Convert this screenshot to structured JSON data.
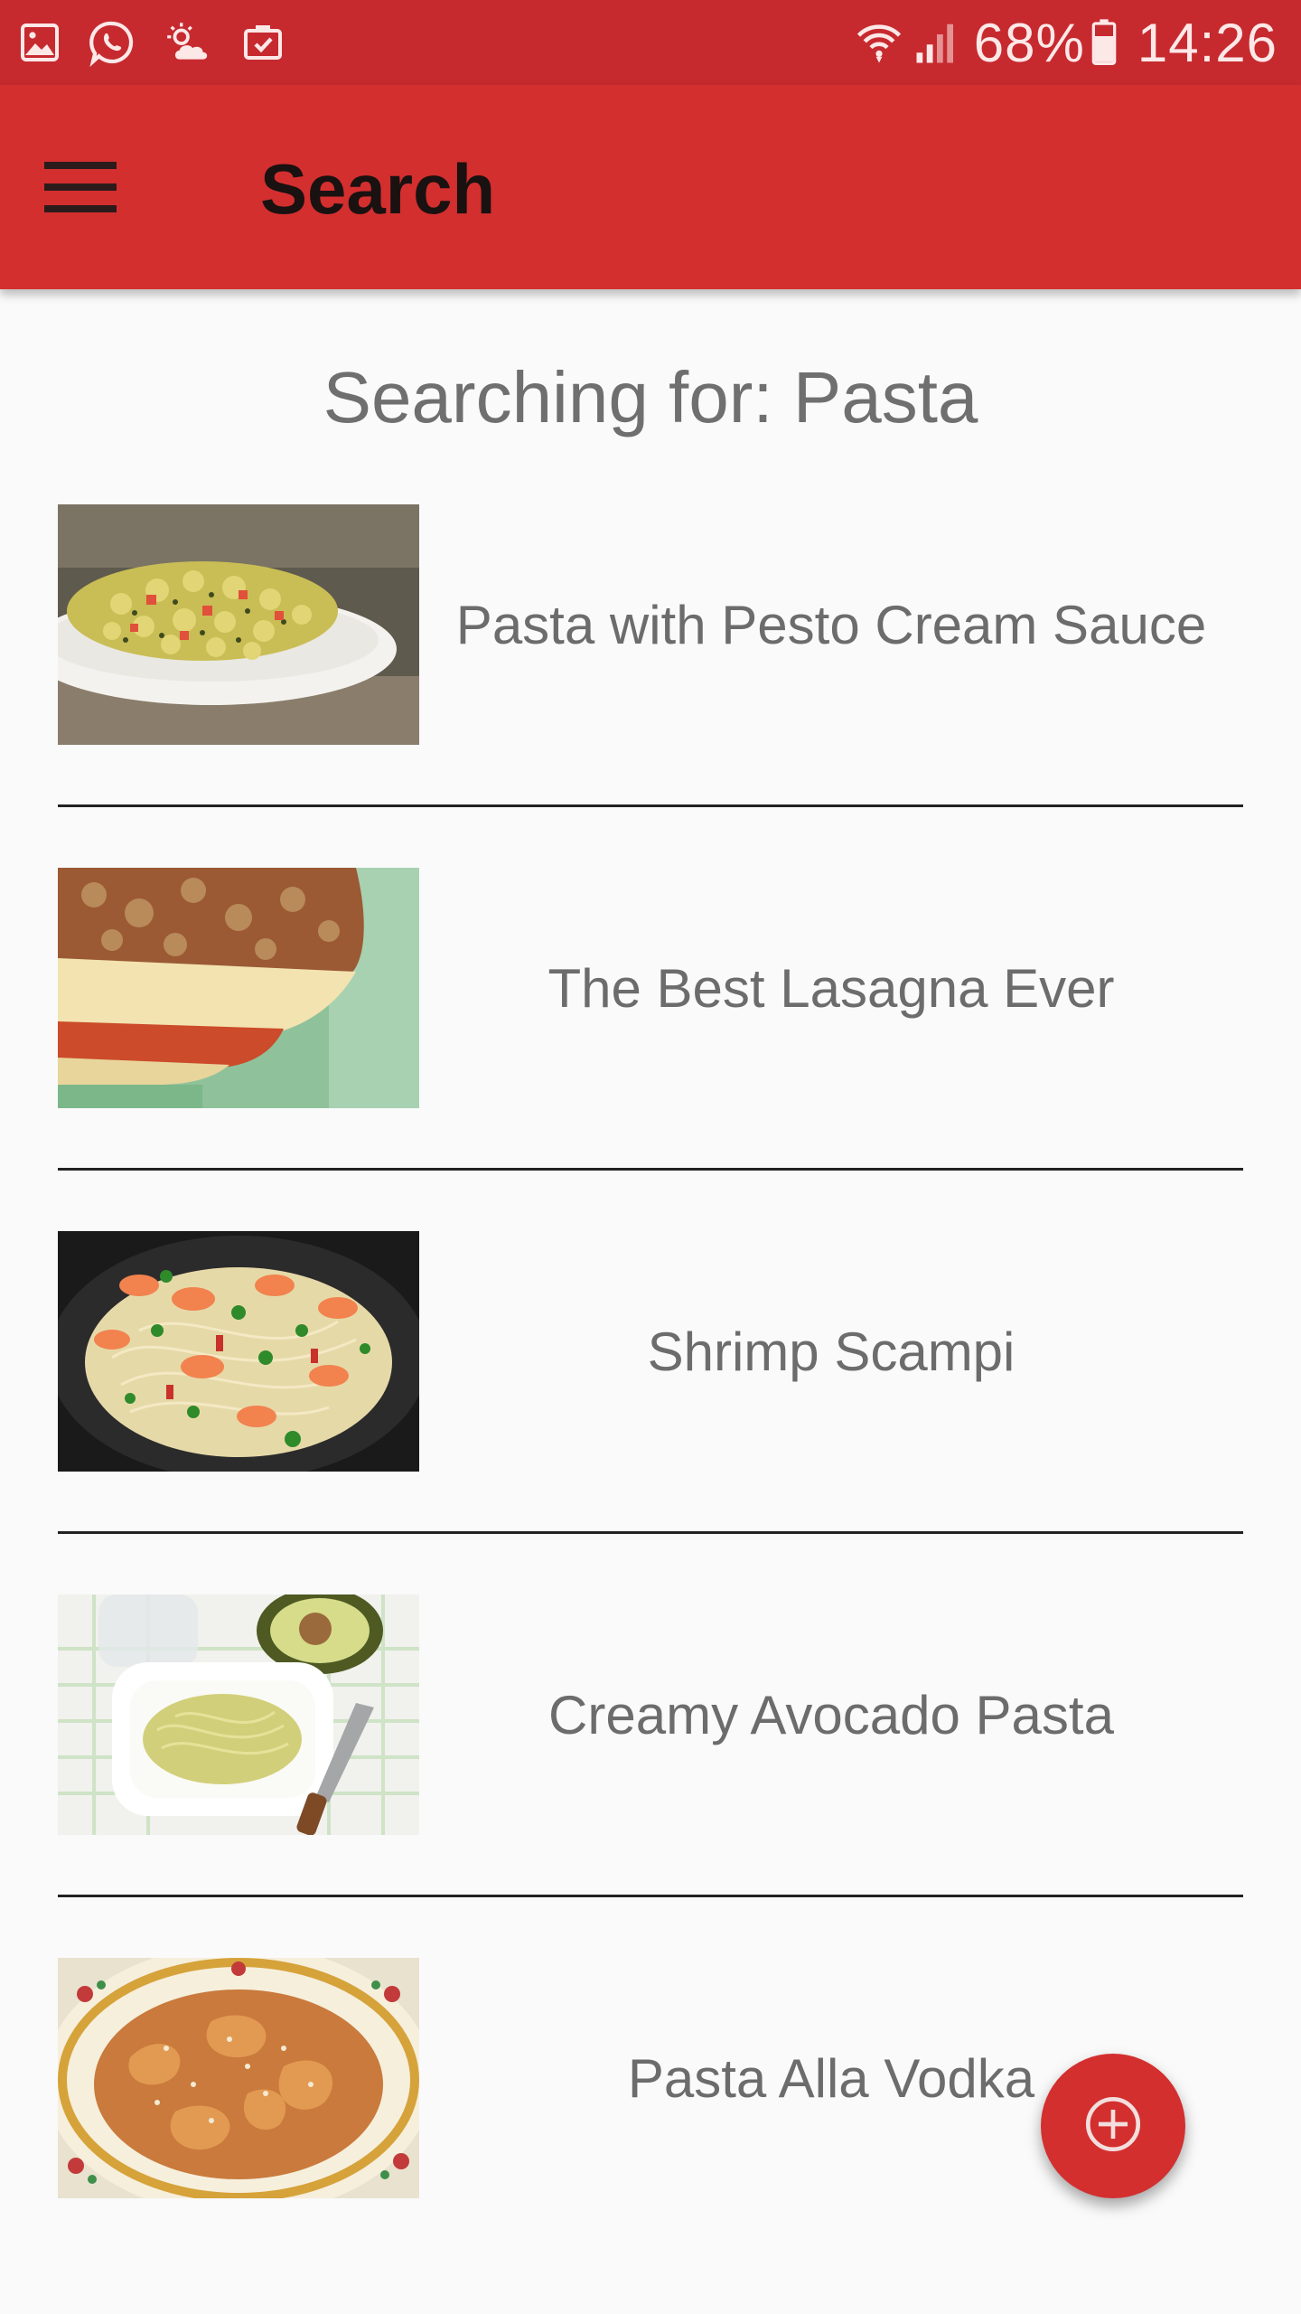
{
  "status_bar": {
    "icons_left": [
      "gallery-icon",
      "whatsapp-icon",
      "weather-icon",
      "briefcase-icon"
    ],
    "icons_right": [
      "wifi-icon",
      "signal-icon",
      "battery-icon"
    ],
    "battery": "68%",
    "time": "14:26",
    "background": "#c62a2f"
  },
  "app_bar": {
    "title": "Search",
    "menu_icon": "menu-icon",
    "background": "#d32f2f"
  },
  "search": {
    "heading": "Searching for: Pasta"
  },
  "recipes": [
    {
      "title": "Pasta with Pesto Cream Sauce",
      "image": "pesto-pasta-image"
    },
    {
      "title": "The Best Lasagna Ever",
      "image": "lasagna-image"
    },
    {
      "title": "Shrimp Scampi",
      "image": "shrimp-scampi-image"
    },
    {
      "title": "Creamy Avocado Pasta",
      "image": "avocado-pasta-image"
    },
    {
      "title": "Pasta Alla Vodka",
      "image": "pasta-vodka-image"
    }
  ],
  "fab": {
    "icon": "add-circle-icon",
    "color": "#d32f2f"
  }
}
